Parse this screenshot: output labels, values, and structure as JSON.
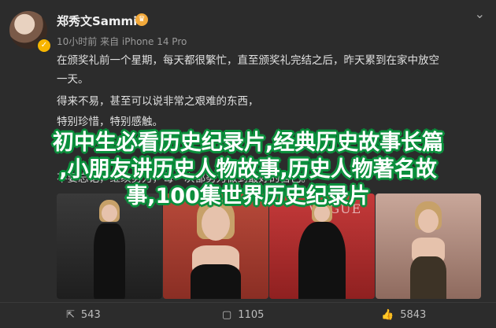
{
  "post": {
    "author": "郑秀文Sammi",
    "meta": "10小时前 来自 iPhone 14 Pro",
    "lines": [
      "在颁奖礼前一个星期，每天都很繁忙，直至颁奖礼完结之后，昨天累到在家中放空",
      "一天。",
      "得来不易，甚至可以说非常之艰难的东西，",
      "特别珍惜，特别感触。"
    ],
    "partial_lines": [
      "不要忘记，继续努力，每一次都努力做到最好的自己。"
    ]
  },
  "overlay": {
    "line1": "初中生必看历史纪录片,经典历史故事长篇",
    "line2": ",小朋友讲历史人物故事,历史人物著名故",
    "line3": "事,100集世界历史纪录片"
  },
  "photos": {
    "p3_watermark": "VOGUE"
  },
  "actions": {
    "share_count": "543",
    "comment_count": "1105",
    "like_count": "5843"
  },
  "colors": {
    "overlay_stroke": "#0b8f3c",
    "background": "#2c2c2c"
  }
}
